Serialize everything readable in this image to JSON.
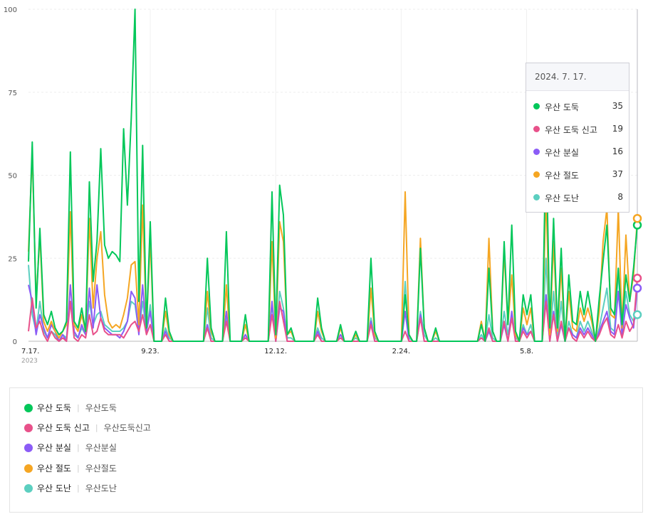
{
  "chart_data": {
    "type": "line",
    "ylim": [
      0,
      100
    ],
    "yticks": [
      "0",
      "25",
      "50",
      "75",
      "100"
    ],
    "xtick_labels": [
      "7.17.",
      "9.23.",
      "12.12.",
      "2.24.",
      "5.8."
    ],
    "start_year_label": "2023",
    "grid": true,
    "series": [
      {
        "name": "우산 도둑",
        "color": "#03c75a",
        "values": [
          24,
          60,
          10,
          34,
          8,
          5,
          9,
          4,
          2,
          3,
          6,
          57,
          6,
          4,
          10,
          3,
          48,
          18,
          30,
          58,
          29,
          25,
          27,
          26,
          24,
          64,
          41,
          67,
          100,
          12,
          59,
          4,
          36,
          0,
          0,
          0,
          13,
          3,
          0,
          0,
          0,
          0,
          0,
          0,
          0,
          0,
          0,
          25,
          4,
          0,
          0,
          0,
          33,
          0,
          0,
          0,
          0,
          8,
          0,
          0,
          0,
          0,
          0,
          0,
          45,
          2,
          47,
          38,
          2,
          4,
          0,
          0,
          0,
          0,
          0,
          0,
          13,
          4,
          0,
          0,
          0,
          0,
          5,
          0,
          0,
          0,
          3,
          0,
          0,
          0,
          25,
          3,
          0,
          0,
          0,
          0,
          0,
          0,
          0,
          14,
          2,
          0,
          0,
          28,
          4,
          0,
          0,
          4,
          0,
          0,
          0,
          0,
          0,
          0,
          0,
          0,
          0,
          0,
          0,
          5,
          0,
          22,
          3,
          0,
          0,
          30,
          5,
          35,
          3,
          0,
          14,
          8,
          14,
          0,
          0,
          0,
          62,
          4,
          37,
          4,
          28,
          0,
          20,
          6,
          5,
          15,
          8,
          15,
          8,
          0,
          13,
          24,
          35,
          10,
          8,
          22,
          5,
          20,
          12,
          22,
          35
        ]
      },
      {
        "name": "우산 도둑 신고",
        "color": "#e8518a",
        "values": [
          3,
          13,
          4,
          6,
          2,
          0,
          3,
          1,
          0,
          1,
          0,
          12,
          1,
          0,
          2,
          1,
          8,
          2,
          3,
          7,
          3,
          2,
          2,
          2,
          2,
          1,
          3,
          5,
          6,
          3,
          8,
          2,
          5,
          0,
          0,
          0,
          2,
          0,
          0,
          0,
          0,
          0,
          0,
          0,
          0,
          0,
          0,
          4,
          0,
          0,
          0,
          0,
          6,
          0,
          0,
          0,
          0,
          1,
          0,
          0,
          0,
          0,
          0,
          0,
          8,
          0,
          12,
          6,
          0,
          0,
          0,
          0,
          0,
          0,
          0,
          0,
          2,
          0,
          0,
          0,
          0,
          0,
          1,
          0,
          0,
          0,
          0,
          0,
          0,
          0,
          5,
          0,
          0,
          0,
          0,
          0,
          0,
          0,
          0,
          3,
          0,
          0,
          0,
          7,
          0,
          0,
          0,
          0,
          0,
          0,
          0,
          0,
          0,
          0,
          0,
          0,
          0,
          0,
          0,
          1,
          0,
          4,
          0,
          0,
          0,
          6,
          0,
          7,
          0,
          0,
          3,
          1,
          3,
          0,
          0,
          0,
          12,
          0,
          8,
          0,
          6,
          0,
          4,
          1,
          0,
          3,
          1,
          3,
          1,
          0,
          2,
          5,
          7,
          2,
          1,
          5,
          1,
          6,
          3,
          5,
          19
        ]
      },
      {
        "name": "우산 분실",
        "color": "#8b5cf6",
        "values": [
          17,
          12,
          2,
          8,
          4,
          1,
          5,
          3,
          0,
          2,
          0,
          17,
          3,
          1,
          5,
          2,
          16,
          4,
          17,
          7,
          4,
          3,
          2,
          2,
          1,
          3,
          6,
          15,
          13,
          2,
          17,
          3,
          9,
          0,
          0,
          0,
          3,
          0,
          0,
          0,
          0,
          0,
          0,
          0,
          0,
          0,
          0,
          5,
          0,
          0,
          0,
          0,
          9,
          0,
          0,
          0,
          0,
          2,
          0,
          0,
          0,
          0,
          0,
          0,
          12,
          0,
          10,
          9,
          0,
          0,
          0,
          0,
          0,
          0,
          0,
          0,
          3,
          0,
          0,
          0,
          0,
          0,
          2,
          0,
          0,
          0,
          0,
          0,
          0,
          0,
          6,
          0,
          0,
          0,
          0,
          0,
          0,
          0,
          0,
          9,
          0,
          0,
          0,
          8,
          0,
          0,
          0,
          0,
          0,
          0,
          0,
          0,
          0,
          0,
          0,
          0,
          0,
          0,
          0,
          1,
          0,
          3,
          0,
          0,
          0,
          5,
          0,
          9,
          0,
          0,
          4,
          2,
          3,
          0,
          0,
          0,
          14,
          0,
          9,
          0,
          5,
          0,
          4,
          2,
          1,
          4,
          2,
          4,
          2,
          0,
          3,
          6,
          9,
          3,
          2,
          15,
          2,
          11,
          7,
          4,
          16
        ]
      },
      {
        "name": "우산 절도",
        "color": "#f5a623",
        "values": [
          27,
          57,
          12,
          32,
          6,
          3,
          6,
          3,
          1,
          3,
          5,
          39,
          5,
          3,
          8,
          3,
          37,
          10,
          25,
          33,
          14,
          6,
          4,
          5,
          4,
          8,
          13,
          23,
          24,
          5,
          41,
          4,
          31,
          0,
          0,
          0,
          9,
          2,
          0,
          0,
          0,
          0,
          0,
          0,
          0,
          0,
          0,
          15,
          3,
          0,
          0,
          0,
          17,
          0,
          0,
          0,
          0,
          5,
          0,
          0,
          0,
          0,
          0,
          0,
          30,
          1,
          36,
          30,
          2,
          3,
          0,
          0,
          0,
          0,
          0,
          0,
          9,
          3,
          0,
          0,
          0,
          0,
          4,
          0,
          0,
          0,
          2,
          0,
          0,
          0,
          16,
          2,
          0,
          0,
          0,
          0,
          0,
          0,
          0,
          45,
          2,
          0,
          0,
          31,
          4,
          0,
          0,
          3,
          0,
          0,
          0,
          0,
          0,
          0,
          0,
          0,
          0,
          0,
          0,
          6,
          0,
          31,
          3,
          0,
          0,
          27,
          5,
          20,
          2,
          0,
          10,
          5,
          10,
          0,
          0,
          0,
          45,
          2,
          30,
          3,
          22,
          0,
          15,
          4,
          3,
          10,
          6,
          10,
          6,
          0,
          9,
          30,
          40,
          8,
          7,
          40,
          4,
          32,
          12,
          20,
          37
        ]
      },
      {
        "name": "우산 도난",
        "color": "#5ccfc0",
        "values": [
          23,
          8,
          3,
          12,
          3,
          1,
          3,
          2,
          0,
          2,
          1,
          12,
          2,
          1,
          4,
          2,
          12,
          5,
          8,
          9,
          5,
          4,
          3,
          3,
          3,
          4,
          6,
          12,
          11,
          3,
          12,
          3,
          11,
          0,
          0,
          0,
          4,
          1,
          0,
          0,
          0,
          0,
          0,
          0,
          0,
          0,
          0,
          10,
          1,
          0,
          0,
          0,
          7,
          0,
          0,
          0,
          0,
          2,
          0,
          0,
          0,
          0,
          0,
          0,
          11,
          0,
          15,
          10,
          1,
          1,
          0,
          0,
          0,
          0,
          0,
          0,
          4,
          1,
          0,
          0,
          0,
          0,
          2,
          0,
          0,
          0,
          1,
          0,
          0,
          0,
          7,
          1,
          0,
          0,
          0,
          0,
          0,
          0,
          0,
          18,
          1,
          0,
          0,
          9,
          2,
          0,
          0,
          1,
          0,
          0,
          0,
          0,
          0,
          0,
          0,
          0,
          0,
          0,
          0,
          2,
          0,
          8,
          1,
          0,
          0,
          9,
          2,
          8,
          1,
          0,
          5,
          2,
          5,
          0,
          0,
          0,
          25,
          1,
          15,
          1,
          12,
          0,
          6,
          2,
          1,
          6,
          3,
          6,
          3,
          0,
          4,
          10,
          16,
          4,
          3,
          21,
          2,
          15,
          8,
          6,
          8
        ]
      }
    ]
  },
  "tooltip": {
    "date": "2024. 7. 17.",
    "items": [
      {
        "name": "우산 도둑",
        "value": "35",
        "color": "#03c75a"
      },
      {
        "name": "우산 도둑 신고",
        "value": "19",
        "color": "#e8518a"
      },
      {
        "name": "우산 분실",
        "value": "16",
        "color": "#8b5cf6"
      },
      {
        "name": "우산 절도",
        "value": "37",
        "color": "#f5a623"
      },
      {
        "name": "우산 도난",
        "value": "8",
        "color": "#5ccfc0"
      }
    ]
  },
  "legend": [
    {
      "name": "우산 도둑",
      "keyword": "우산도둑",
      "color": "#03c75a"
    },
    {
      "name": "우산 도둑 신고",
      "keyword": "우산도둑신고",
      "color": "#e8518a"
    },
    {
      "name": "우산 분실",
      "keyword": "우산분실",
      "color": "#8b5cf6"
    },
    {
      "name": "우산 절도",
      "keyword": "우산절도",
      "color": "#f5a623"
    },
    {
      "name": "우산 도난",
      "keyword": "우산도난",
      "color": "#5ccfc0"
    }
  ],
  "legend_separator": "|"
}
